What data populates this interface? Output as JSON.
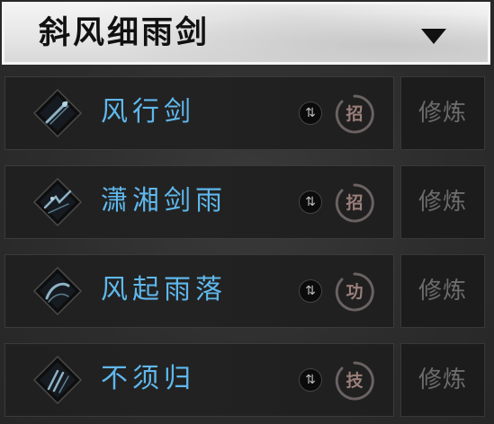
{
  "header": {
    "title": "斜风细雨剑"
  },
  "skills": [
    {
      "name": "风行剑",
      "type_char": "招",
      "train_label": "修炼"
    },
    {
      "name": "潇湘剑雨",
      "type_char": "招",
      "train_label": "修炼"
    },
    {
      "name": "风起雨落",
      "type_char": "功",
      "train_label": "修炼"
    },
    {
      "name": "不须归",
      "type_char": "技",
      "train_label": "修炼"
    }
  ],
  "colors": {
    "skill_name": "#5fb8ec",
    "header_bg": "#ececec",
    "panel_bg": "#2f2f2f",
    "row_bg": "#202020",
    "train_text": "#6c6c6c",
    "seal_color": "#9a7f7a"
  },
  "icons": {
    "dropdown": "triangle-down-icon",
    "swap": "swap-icon",
    "seal": "brush-circle-seal-icon",
    "skill": "diamond-skill-icon"
  }
}
